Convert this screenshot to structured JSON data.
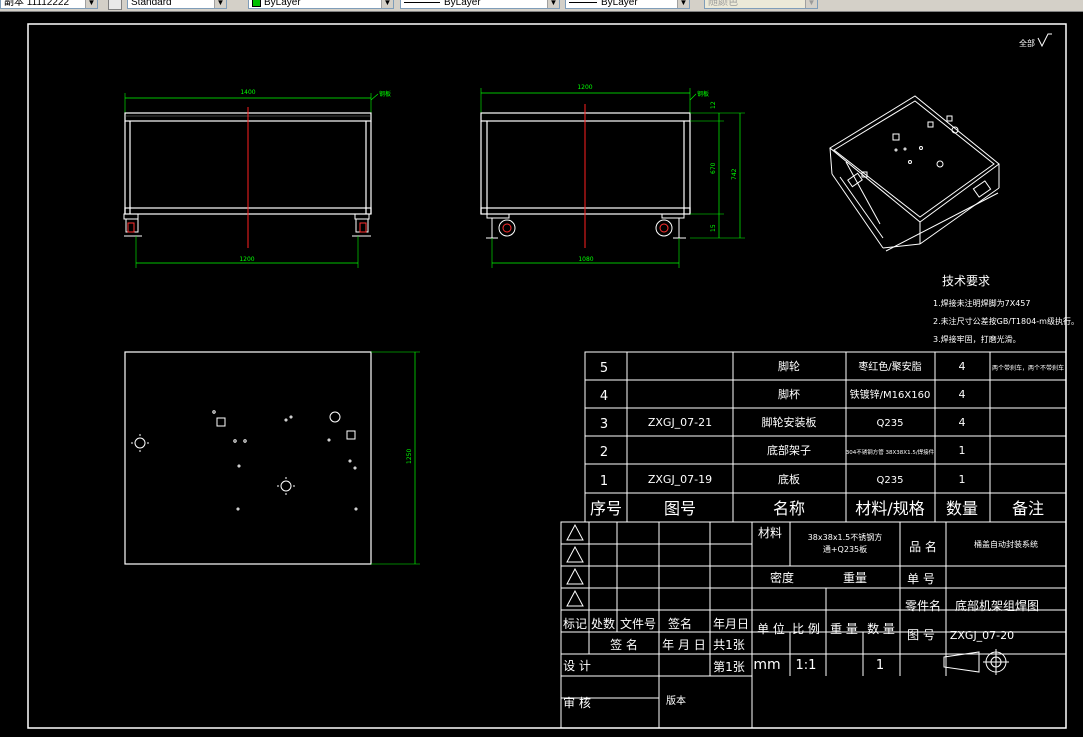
{
  "toolbar": {
    "layer_prefix": "副本",
    "layer_value": "11112222",
    "text_style": "Standard",
    "color": "ByLayer",
    "linetype": "ByLayer",
    "lineweight": "ByLayer",
    "plot_style": "随颜色"
  },
  "drawing": {
    "surface_symbol": "全部",
    "front_view": {
      "width_top": "1400",
      "width_bottom": "1200",
      "leader": "钢板"
    },
    "side_view": {
      "width_top": "1200",
      "width_bottom": "1080",
      "dim_small_top": "12",
      "dim_height": "670",
      "dim_total": "742",
      "dim_small_bottom": "15",
      "leader": "钢板"
    },
    "plate_view": {
      "height": "1250"
    },
    "tech_title": "技术要求",
    "tech_items": [
      "1.焊接未注明焊脚为7X457",
      "2.未注尺寸公差按GB/T1804-m级执行。",
      "3.焊接牢固，打磨光滑。"
    ]
  },
  "bom": {
    "headers": [
      "序号",
      "图号",
      "名称",
      "材料/规格",
      "数量",
      "备注"
    ],
    "rows": [
      {
        "no": "5",
        "drawing": "",
        "name": "脚轮",
        "material": "枣红色/聚安脂",
        "qty": "4",
        "note": "两个带刹车，两个不带刹车"
      },
      {
        "no": "4",
        "drawing": "",
        "name": "脚杯",
        "material": "铁镀锌/M16X160",
        "qty": "4",
        "note": ""
      },
      {
        "no": "3",
        "drawing": "ZXGJ_07-21",
        "name": "脚轮安装板",
        "material": "Q235",
        "qty": "4",
        "note": ""
      },
      {
        "no": "2",
        "drawing": "",
        "name": "底部架子",
        "material": "304不锈钢方管 38X38X1.5/焊接件",
        "qty": "1",
        "note": ""
      },
      {
        "no": "1",
        "drawing": "ZXGJ_07-19",
        "name": "底板",
        "material": "Q235",
        "qty": "1",
        "note": ""
      }
    ]
  },
  "title_block": {
    "material_label": "材料",
    "material_value_1": "38x38x1.5不锈钢方",
    "material_value_2": "通+Q235板",
    "product_label": "品 名",
    "product_value": "桶盖自动封装系统",
    "density_label": "密度",
    "weight_label": "重量",
    "unit_no_label": "单 号",
    "part_name_label": "零件名",
    "part_name_value": "底部机架组焊图",
    "drawing_no_label": "图 号",
    "drawing_no_value": "ZXGJ_07-20",
    "rev_header": [
      "标记",
      "处数",
      "文件号",
      "签名",
      "年月日"
    ],
    "unit_label": "单 位",
    "scale_label": "比 例",
    "weight2_label": "重 量",
    "qty_label": "数 量",
    "sign_label": "签 名",
    "date_label": "年 月 日",
    "total_sheets": "共1张",
    "sheet_no": "第1张",
    "unit_value": "mm",
    "scale_value": "1:1",
    "qty_value": "1",
    "design_label": "设 计",
    "review_label": "审 核",
    "version_label": "版本"
  }
}
